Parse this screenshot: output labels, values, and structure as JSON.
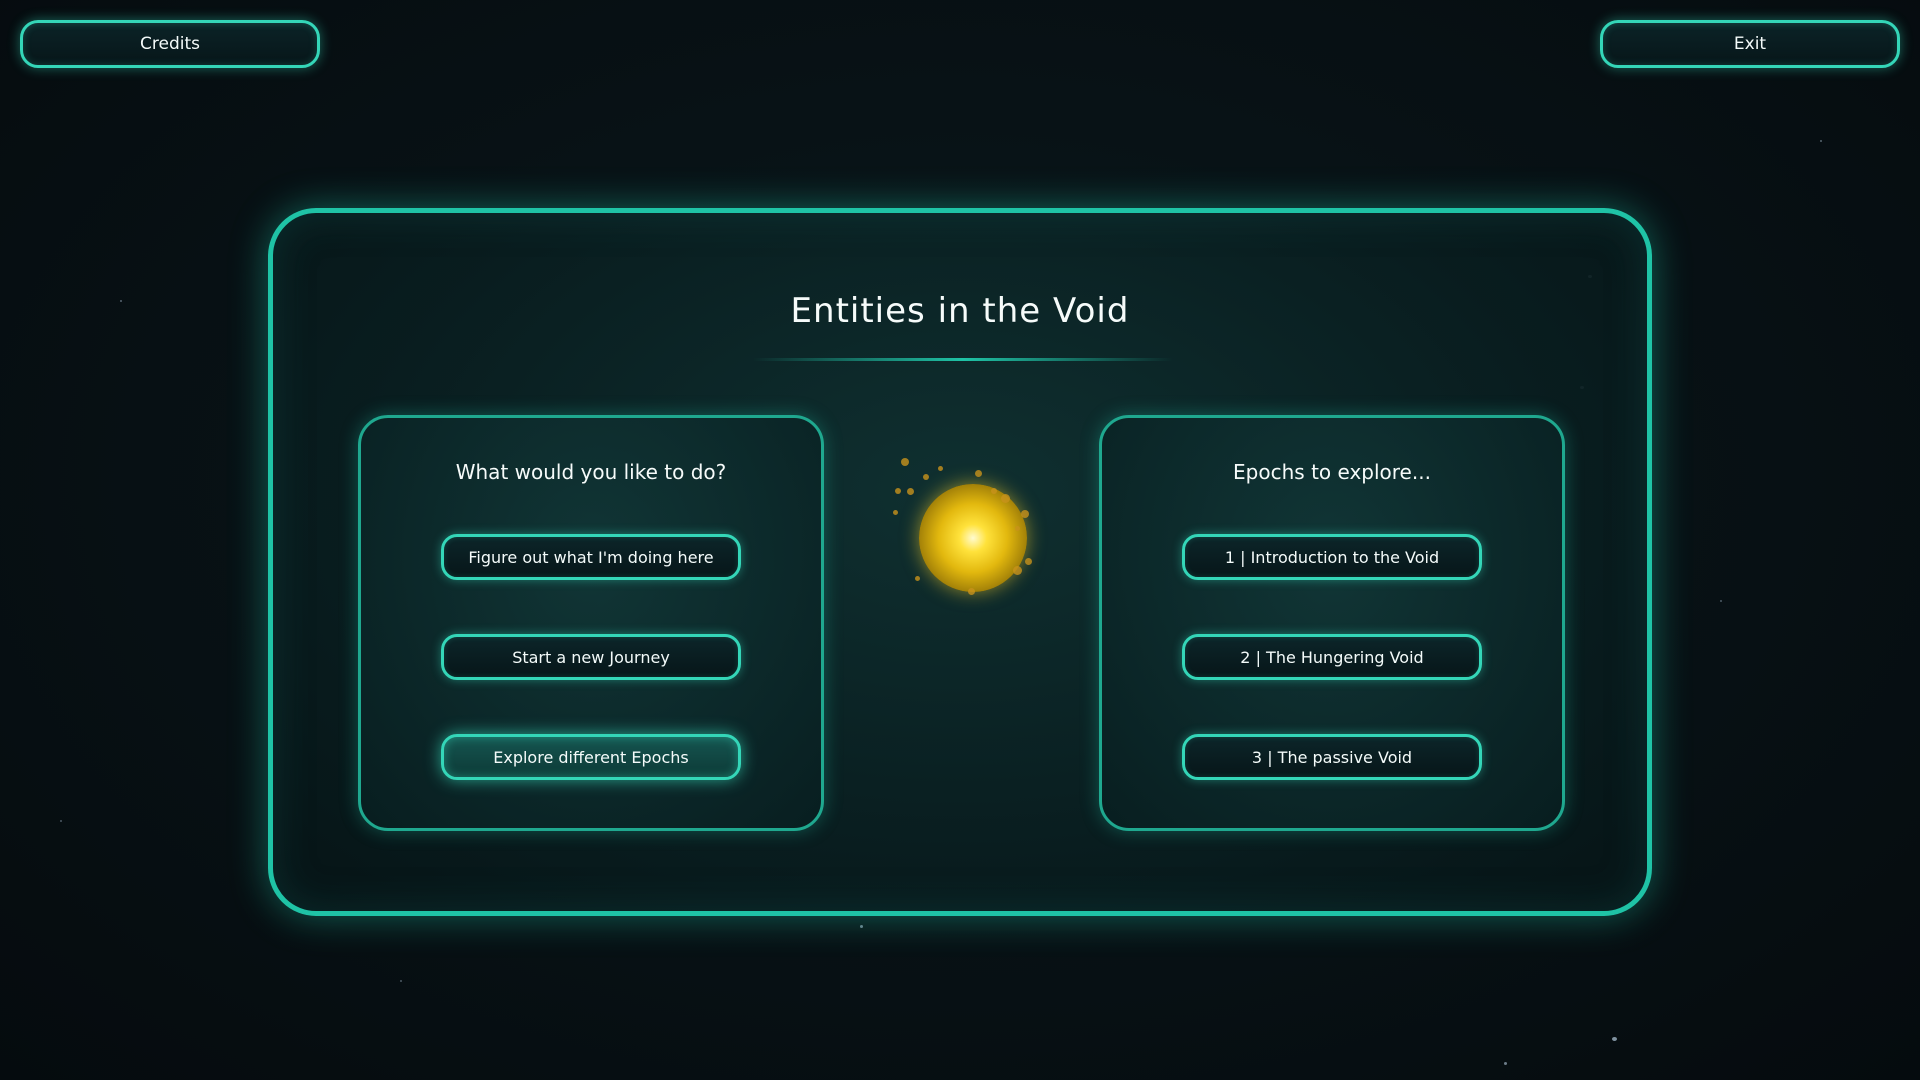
{
  "header": {
    "credits_label": "Credits",
    "exit_label": "Exit"
  },
  "main": {
    "title": "Entities in the Void",
    "left_panel": {
      "title": "What would you like to do?",
      "buttons": [
        {
          "label": "Figure out what I'm doing here"
        },
        {
          "label": "Start a new Journey"
        },
        {
          "label": "Explore different Epochs"
        }
      ]
    },
    "right_panel": {
      "title": "Epochs to explore...",
      "buttons": [
        {
          "label": "1 | Introduction to the Void"
        },
        {
          "label": "2 | The Hungering Void"
        },
        {
          "label": "3 | The passive Void"
        }
      ]
    }
  },
  "colors": {
    "accent": "#1fc3a6",
    "orb": "#ffe23b",
    "background": "#081216"
  },
  "icons": {
    "center": "glowing-orb-icon"
  }
}
